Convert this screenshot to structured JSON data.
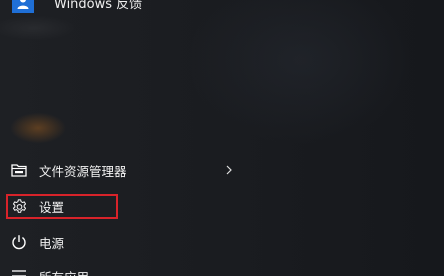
{
  "start_menu": {
    "top_app": {
      "label": "Windows 反馈",
      "icon": "person-icon"
    },
    "items": [
      {
        "label": "文件资源管理器",
        "icon": "folder-icon",
        "has_submenu": true
      },
      {
        "label": "设置",
        "icon": "gear-icon",
        "highlighted": true
      },
      {
        "label": "电源",
        "icon": "power-icon"
      },
      {
        "label": "所有应用",
        "icon": "list-icon"
      }
    ]
  },
  "colors": {
    "background": "#1a1c20",
    "tile_accent": "#1f6fd6",
    "highlight": "#d8232a",
    "text": "#f2f2f2"
  }
}
